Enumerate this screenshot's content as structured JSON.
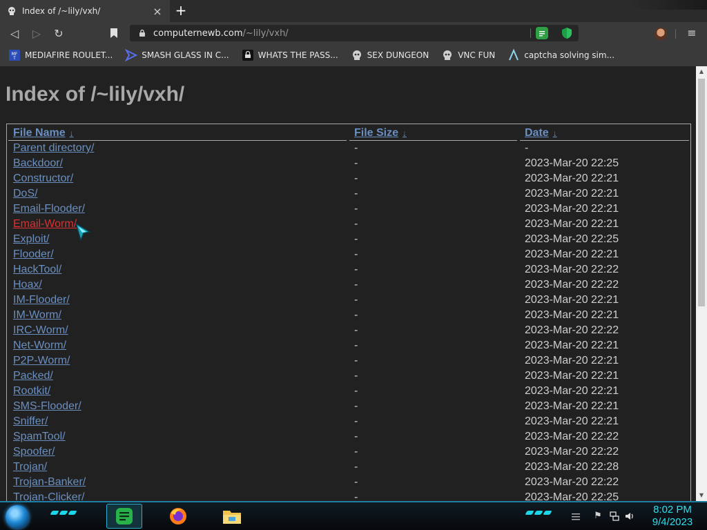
{
  "tab": {
    "title": "Index of /~lily/vxh/",
    "close": "×"
  },
  "newtab": {
    "label": "+"
  },
  "toolbar": {
    "back": "◁",
    "forward": "▷",
    "reload": "↻",
    "menu": "≡"
  },
  "address": {
    "host": "computernewb.com",
    "path": "/~lily/vxh/"
  },
  "bookmarks": [
    {
      "label": "MEDIAFIRE ROULET...",
      "icon": "mediafire-icon"
    },
    {
      "label": "SMASH GLASS IN C...",
      "icon": "smash-glass-icon"
    },
    {
      "label": "WHATS THE PASS...",
      "icon": "whats-the-pass-icon"
    },
    {
      "label": "SEX DUNGEON",
      "icon": "vnc-icon"
    },
    {
      "label": "VNC FUN",
      "icon": "vnc-icon"
    },
    {
      "label": "captcha solving sim...",
      "icon": "captcha-icon"
    }
  ],
  "page": {
    "title": "Index of /~lily/vxh/",
    "headers": {
      "name": "File Name",
      "size": "File Size",
      "date": "Date",
      "sort_arrow": "↓"
    }
  },
  "rows": [
    {
      "name": "Parent directory/",
      "size": "-",
      "date": "-"
    },
    {
      "name": "Backdoor/",
      "size": "-",
      "date": "2023-Mar-20 22:25"
    },
    {
      "name": "Constructor/",
      "size": "-",
      "date": "2023-Mar-20 22:21"
    },
    {
      "name": "DoS/",
      "size": "-",
      "date": "2023-Mar-20 22:21"
    },
    {
      "name": "Email-Flooder/",
      "size": "-",
      "date": "2023-Mar-20 22:21"
    },
    {
      "name": "Email-Worm/",
      "size": "-",
      "date": "2023-Mar-20 22:21",
      "hover": true
    },
    {
      "name": "Exploit/",
      "size": "-",
      "date": "2023-Mar-20 22:25"
    },
    {
      "name": "Flooder/",
      "size": "-",
      "date": "2023-Mar-20 22:21"
    },
    {
      "name": "HackTool/",
      "size": "-",
      "date": "2023-Mar-20 22:22"
    },
    {
      "name": "Hoax/",
      "size": "-",
      "date": "2023-Mar-20 22:22"
    },
    {
      "name": "IM-Flooder/",
      "size": "-",
      "date": "2023-Mar-20 22:21"
    },
    {
      "name": "IM-Worm/",
      "size": "-",
      "date": "2023-Mar-20 22:21"
    },
    {
      "name": "IRC-Worm/",
      "size": "-",
      "date": "2023-Mar-20 22:22"
    },
    {
      "name": "Net-Worm/",
      "size": "-",
      "date": "2023-Mar-20 22:21"
    },
    {
      "name": "P2P-Worm/",
      "size": "-",
      "date": "2023-Mar-20 22:21"
    },
    {
      "name": "Packed/",
      "size": "-",
      "date": "2023-Mar-20 22:21"
    },
    {
      "name": "Rootkit/",
      "size": "-",
      "date": "2023-Mar-20 22:21"
    },
    {
      "name": "SMS-Flooder/",
      "size": "-",
      "date": "2023-Mar-20 22:21"
    },
    {
      "name": "Sniffer/",
      "size": "-",
      "date": "2023-Mar-20 22:21"
    },
    {
      "name": "SpamTool/",
      "size": "-",
      "date": "2023-Mar-20 22:22"
    },
    {
      "name": "Spoofer/",
      "size": "-",
      "date": "2023-Mar-20 22:22"
    },
    {
      "name": "Trojan/",
      "size": "-",
      "date": "2023-Mar-20 22:28"
    },
    {
      "name": "Trojan-Banker/",
      "size": "-",
      "date": "2023-Mar-20 22:22"
    },
    {
      "name": "Trojan-Clicker/",
      "size": "-",
      "date": "2023-Mar-20 22:25"
    }
  ],
  "scrollbar": {
    "up": "▲",
    "down": "▼"
  },
  "taskbar": {
    "apps": [
      {
        "name": "notes-app-icon",
        "active": true
      },
      {
        "name": "firefox-icon",
        "active": false
      },
      {
        "name": "file-explorer-icon",
        "active": false
      }
    ],
    "tray": {
      "flag": "⚑",
      "network": "🖧",
      "volume": "🔊"
    },
    "clock": {
      "time": "8:02 PM",
      "date": "9/4/2023"
    }
  },
  "colors": {
    "link": "#6a8fc0",
    "link_hover": "#e03030",
    "accent": "#2ee0ee"
  }
}
